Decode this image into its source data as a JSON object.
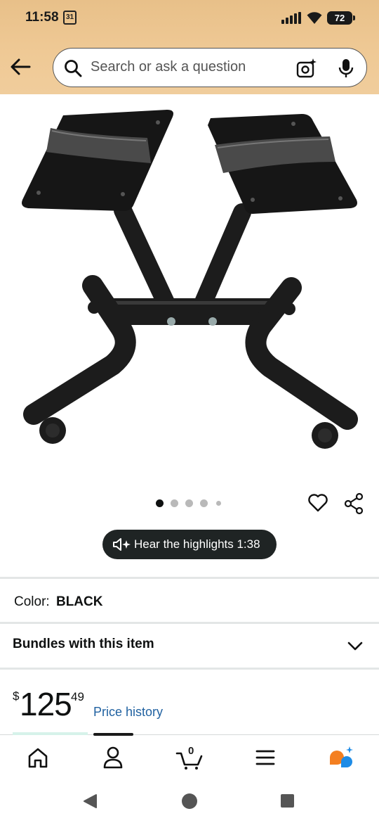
{
  "status_bar": {
    "time": "11:58",
    "calendar_day": "31",
    "battery": "72"
  },
  "search": {
    "placeholder": "Search or ask a question"
  },
  "product": {
    "image_icon": "adjustable-dumbbell-stand-image",
    "carousel_total": 5,
    "carousel_active": 1
  },
  "highlights": {
    "label": "Hear the highlights 1:38"
  },
  "color": {
    "label": "Color:",
    "value": "BLACK"
  },
  "bundles": {
    "label": "Bundles with this item"
  },
  "price": {
    "currency": "$",
    "whole": "125",
    "fraction": "49",
    "history_link": "Price history"
  },
  "bottom_nav": {
    "cart_count": "0",
    "items": [
      "home-icon",
      "account-icon",
      "cart-icon",
      "menu-icon",
      "rufus-icon"
    ]
  },
  "colors": {
    "header_bg": "#efc995",
    "link": "#2162a1",
    "pill_bg": "#1f2424",
    "rufus_orange": "#f47f20",
    "rufus_blue": "#1f8ce6"
  }
}
